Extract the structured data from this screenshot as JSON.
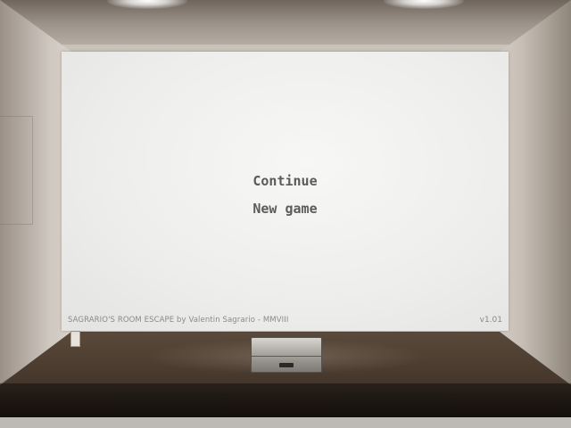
{
  "game": {
    "menu": {
      "continue_label": "Continue",
      "new_game_label": "New game"
    },
    "credits": "SAGRARIO'S ROOM ESCAPE  by Valentin Sagrario - MMVIII",
    "version": "v1.01"
  },
  "scene": {
    "objects": [
      "briefcase",
      "wall-outlet",
      "ceiling-lights"
    ],
    "colors": {
      "panel": "#efefee",
      "menu_text": "#5b5b5b",
      "floor": "#4a3b2f"
    }
  }
}
